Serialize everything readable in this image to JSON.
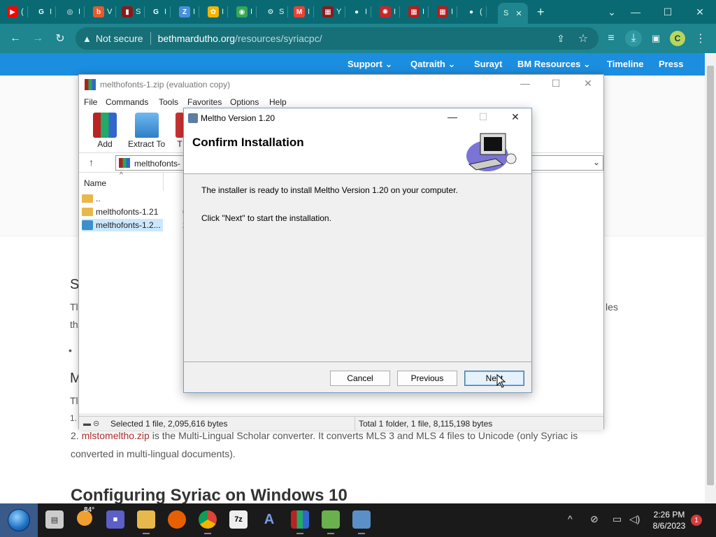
{
  "browser": {
    "tabs": [
      {
        "icon": "youtube-icon",
        "color": "#ff0000",
        "glyph": "▶",
        "label": "("
      },
      {
        "icon": "google-icon",
        "color": "#ffffff",
        "glyph": "G",
        "label": "I"
      },
      {
        "icon": "chrome-icon",
        "color": "#ffffff",
        "glyph": "◎",
        "label": "I"
      },
      {
        "icon": "blogger-icon",
        "color": "#e65a2d",
        "glyph": "b",
        "label": "V"
      },
      {
        "icon": "app-icon",
        "color": "#8b1a1a",
        "glyph": "▮",
        "label": "S"
      },
      {
        "icon": "google-icon",
        "color": "#ffffff",
        "glyph": "G",
        "label": "I"
      },
      {
        "icon": "colorful-icon",
        "color": "#4a90d9",
        "glyph": "Z",
        "label": "I"
      },
      {
        "icon": "photos-icon",
        "color": "#f4b400",
        "glyph": "✿",
        "label": "I"
      },
      {
        "icon": "maps-icon",
        "color": "#34a853",
        "glyph": "◉",
        "label": "I"
      },
      {
        "icon": "settings-icon",
        "color": "#ffffff",
        "glyph": "⚙",
        "label": "S"
      },
      {
        "icon": "gmail-icon",
        "color": "#ea4335",
        "glyph": "M",
        "label": "I"
      },
      {
        "icon": "winrar-icon",
        "color": "#8b1a1a",
        "glyph": "▦",
        "label": "Y"
      },
      {
        "icon": "github-icon",
        "color": "#ffffff",
        "glyph": "●",
        "label": "I"
      },
      {
        "icon": "target-icon",
        "color": "#c62828",
        "glyph": "✺",
        "label": "I"
      },
      {
        "icon": "winrar-icon",
        "color": "#b71c1c",
        "glyph": "▦",
        "label": "I"
      },
      {
        "icon": "winrar-icon",
        "color": "#b71c1c",
        "glyph": "▦",
        "label": "I"
      },
      {
        "icon": "github-icon",
        "color": "#ffffff",
        "glyph": "●",
        "label": "("
      }
    ],
    "active_tab_label": "S",
    "new_tab": "+",
    "address": {
      "security_label": "Not secure",
      "host": "bethmardutho.org",
      "path": "/resources/syriacpc/"
    },
    "profile_initial": "C"
  },
  "site": {
    "nav": [
      "Support",
      "Qatraith",
      "Surayt",
      "BM Resources",
      "Timeline",
      "Press"
    ],
    "body_fragments": {
      "s_h": "S",
      "t1": "Tl",
      "t2": "th",
      "bullet": "•",
      "m_h": "M",
      "t3": "Tl",
      "t4": "1.",
      "les": "les"
    },
    "line2_prefix": "2. ",
    "line2_link": "mlstomeltho.zip",
    "line2_rest": " is the Multi-Lingual Scholar converter. It converts MLS 3 and MLS 4 files to Unicode (only Syriac is",
    "line3": "converted in multi-lingual documents).",
    "heading": "Configuring Syriac on Windows 10"
  },
  "winrar": {
    "title": "melthofonts-1.zip (evaluation copy)",
    "menu": [
      "File",
      "Commands",
      "Tools",
      "Favorites",
      "Options",
      "Help"
    ],
    "tools": [
      {
        "label": "Add",
        "icon": "add-archive-icon"
      },
      {
        "label": "Extract To",
        "icon": "extract-folder-icon"
      },
      {
        "label": "T",
        "icon": "test-icon"
      }
    ],
    "path": "melthofonts-",
    "column_name": "Name",
    "rows": [
      {
        "name": "..",
        "icon": "folder-up-icon",
        "extra": ""
      },
      {
        "name": "melthofonts-1.21",
        "icon": "folder-icon",
        "extra": "6"
      },
      {
        "name": "melthofonts-1.2...",
        "icon": "installer-file-icon",
        "extra": "2"
      }
    ],
    "status_left": "Selected 1 file, 2,095,616 bytes",
    "status_right": "Total 1 folder, 1 file, 8,115,198 bytes"
  },
  "dialog": {
    "title": "Meltho Version 1.20",
    "heading": "Confirm Installation",
    "line1": "The installer is ready to install Meltho Version 1.20 on your computer.",
    "line2": "Click \"Next\" to start the installation.",
    "cancel": "Cancel",
    "previous": "Previous",
    "next": "Next"
  },
  "taskbar": {
    "weather": "84°",
    "time": "2:26 PM",
    "date": "8/6/2023",
    "notifications": "1"
  }
}
